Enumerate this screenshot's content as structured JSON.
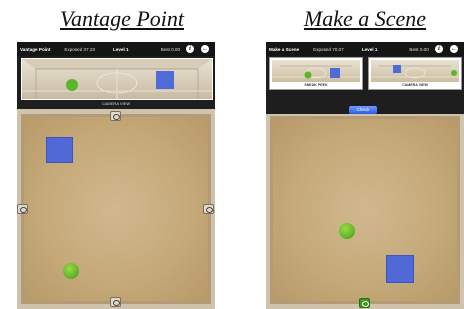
{
  "captions": {
    "left": "Vantage Point",
    "right": "Make a Scene"
  },
  "vantage": {
    "title": "Vantage Point",
    "exposed": "Exposed 37.33",
    "level": "Level 1",
    "best": "Best 0.00",
    "info_icon": "i",
    "back_icon": "←",
    "camera_view_label": "CAMERA VIEW"
  },
  "scene": {
    "title": "Make a Scene",
    "exposed": "Exposed 70.07",
    "level": "Level 1",
    "best": "Best 0.00",
    "info_icon": "i",
    "back_icon": "←",
    "sneak_peek_label": "SNEAK PEEK",
    "camera_view_label": "CAMERA VIEW",
    "check_label": "Check"
  },
  "colors": {
    "cube": "#5069d6",
    "ball": "#4fae22",
    "topbar": "#151515"
  }
}
